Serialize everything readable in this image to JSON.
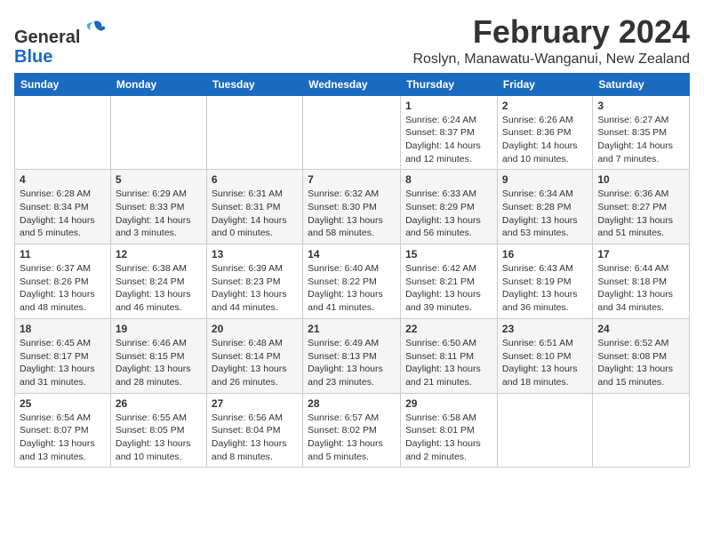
{
  "app": {
    "name": "GeneralBlue",
    "logo_text_general": "General",
    "logo_text_blue": "Blue"
  },
  "header": {
    "month_title": "February 2024",
    "location": "Roslyn, Manawatu-Wanganui, New Zealand"
  },
  "weekdays": [
    "Sunday",
    "Monday",
    "Tuesday",
    "Wednesday",
    "Thursday",
    "Friday",
    "Saturday"
  ],
  "weeks": [
    [
      {
        "day": "",
        "info": ""
      },
      {
        "day": "",
        "info": ""
      },
      {
        "day": "",
        "info": ""
      },
      {
        "day": "",
        "info": ""
      },
      {
        "day": "1",
        "info": "Sunrise: 6:24 AM\nSunset: 8:37 PM\nDaylight: 14 hours and 12 minutes."
      },
      {
        "day": "2",
        "info": "Sunrise: 6:26 AM\nSunset: 8:36 PM\nDaylight: 14 hours and 10 minutes."
      },
      {
        "day": "3",
        "info": "Sunrise: 6:27 AM\nSunset: 8:35 PM\nDaylight: 14 hours and 7 minutes."
      }
    ],
    [
      {
        "day": "4",
        "info": "Sunrise: 6:28 AM\nSunset: 8:34 PM\nDaylight: 14 hours and 5 minutes."
      },
      {
        "day": "5",
        "info": "Sunrise: 6:29 AM\nSunset: 8:33 PM\nDaylight: 14 hours and 3 minutes."
      },
      {
        "day": "6",
        "info": "Sunrise: 6:31 AM\nSunset: 8:31 PM\nDaylight: 14 hours and 0 minutes."
      },
      {
        "day": "7",
        "info": "Sunrise: 6:32 AM\nSunset: 8:30 PM\nDaylight: 13 hours and 58 minutes."
      },
      {
        "day": "8",
        "info": "Sunrise: 6:33 AM\nSunset: 8:29 PM\nDaylight: 13 hours and 56 minutes."
      },
      {
        "day": "9",
        "info": "Sunrise: 6:34 AM\nSunset: 8:28 PM\nDaylight: 13 hours and 53 minutes."
      },
      {
        "day": "10",
        "info": "Sunrise: 6:36 AM\nSunset: 8:27 PM\nDaylight: 13 hours and 51 minutes."
      }
    ],
    [
      {
        "day": "11",
        "info": "Sunrise: 6:37 AM\nSunset: 8:26 PM\nDaylight: 13 hours and 48 minutes."
      },
      {
        "day": "12",
        "info": "Sunrise: 6:38 AM\nSunset: 8:24 PM\nDaylight: 13 hours and 46 minutes."
      },
      {
        "day": "13",
        "info": "Sunrise: 6:39 AM\nSunset: 8:23 PM\nDaylight: 13 hours and 44 minutes."
      },
      {
        "day": "14",
        "info": "Sunrise: 6:40 AM\nSunset: 8:22 PM\nDaylight: 13 hours and 41 minutes."
      },
      {
        "day": "15",
        "info": "Sunrise: 6:42 AM\nSunset: 8:21 PM\nDaylight: 13 hours and 39 minutes."
      },
      {
        "day": "16",
        "info": "Sunrise: 6:43 AM\nSunset: 8:19 PM\nDaylight: 13 hours and 36 minutes."
      },
      {
        "day": "17",
        "info": "Sunrise: 6:44 AM\nSunset: 8:18 PM\nDaylight: 13 hours and 34 minutes."
      }
    ],
    [
      {
        "day": "18",
        "info": "Sunrise: 6:45 AM\nSunset: 8:17 PM\nDaylight: 13 hours and 31 minutes."
      },
      {
        "day": "19",
        "info": "Sunrise: 6:46 AM\nSunset: 8:15 PM\nDaylight: 13 hours and 28 minutes."
      },
      {
        "day": "20",
        "info": "Sunrise: 6:48 AM\nSunset: 8:14 PM\nDaylight: 13 hours and 26 minutes."
      },
      {
        "day": "21",
        "info": "Sunrise: 6:49 AM\nSunset: 8:13 PM\nDaylight: 13 hours and 23 minutes."
      },
      {
        "day": "22",
        "info": "Sunrise: 6:50 AM\nSunset: 8:11 PM\nDaylight: 13 hours and 21 minutes."
      },
      {
        "day": "23",
        "info": "Sunrise: 6:51 AM\nSunset: 8:10 PM\nDaylight: 13 hours and 18 minutes."
      },
      {
        "day": "24",
        "info": "Sunrise: 6:52 AM\nSunset: 8:08 PM\nDaylight: 13 hours and 15 minutes."
      }
    ],
    [
      {
        "day": "25",
        "info": "Sunrise: 6:54 AM\nSunset: 8:07 PM\nDaylight: 13 hours and 13 minutes."
      },
      {
        "day": "26",
        "info": "Sunrise: 6:55 AM\nSunset: 8:05 PM\nDaylight: 13 hours and 10 minutes."
      },
      {
        "day": "27",
        "info": "Sunrise: 6:56 AM\nSunset: 8:04 PM\nDaylight: 13 hours and 8 minutes."
      },
      {
        "day": "28",
        "info": "Sunrise: 6:57 AM\nSunset: 8:02 PM\nDaylight: 13 hours and 5 minutes."
      },
      {
        "day": "29",
        "info": "Sunrise: 6:58 AM\nSunset: 8:01 PM\nDaylight: 13 hours and 2 minutes."
      },
      {
        "day": "",
        "info": ""
      },
      {
        "day": "",
        "info": ""
      }
    ]
  ]
}
